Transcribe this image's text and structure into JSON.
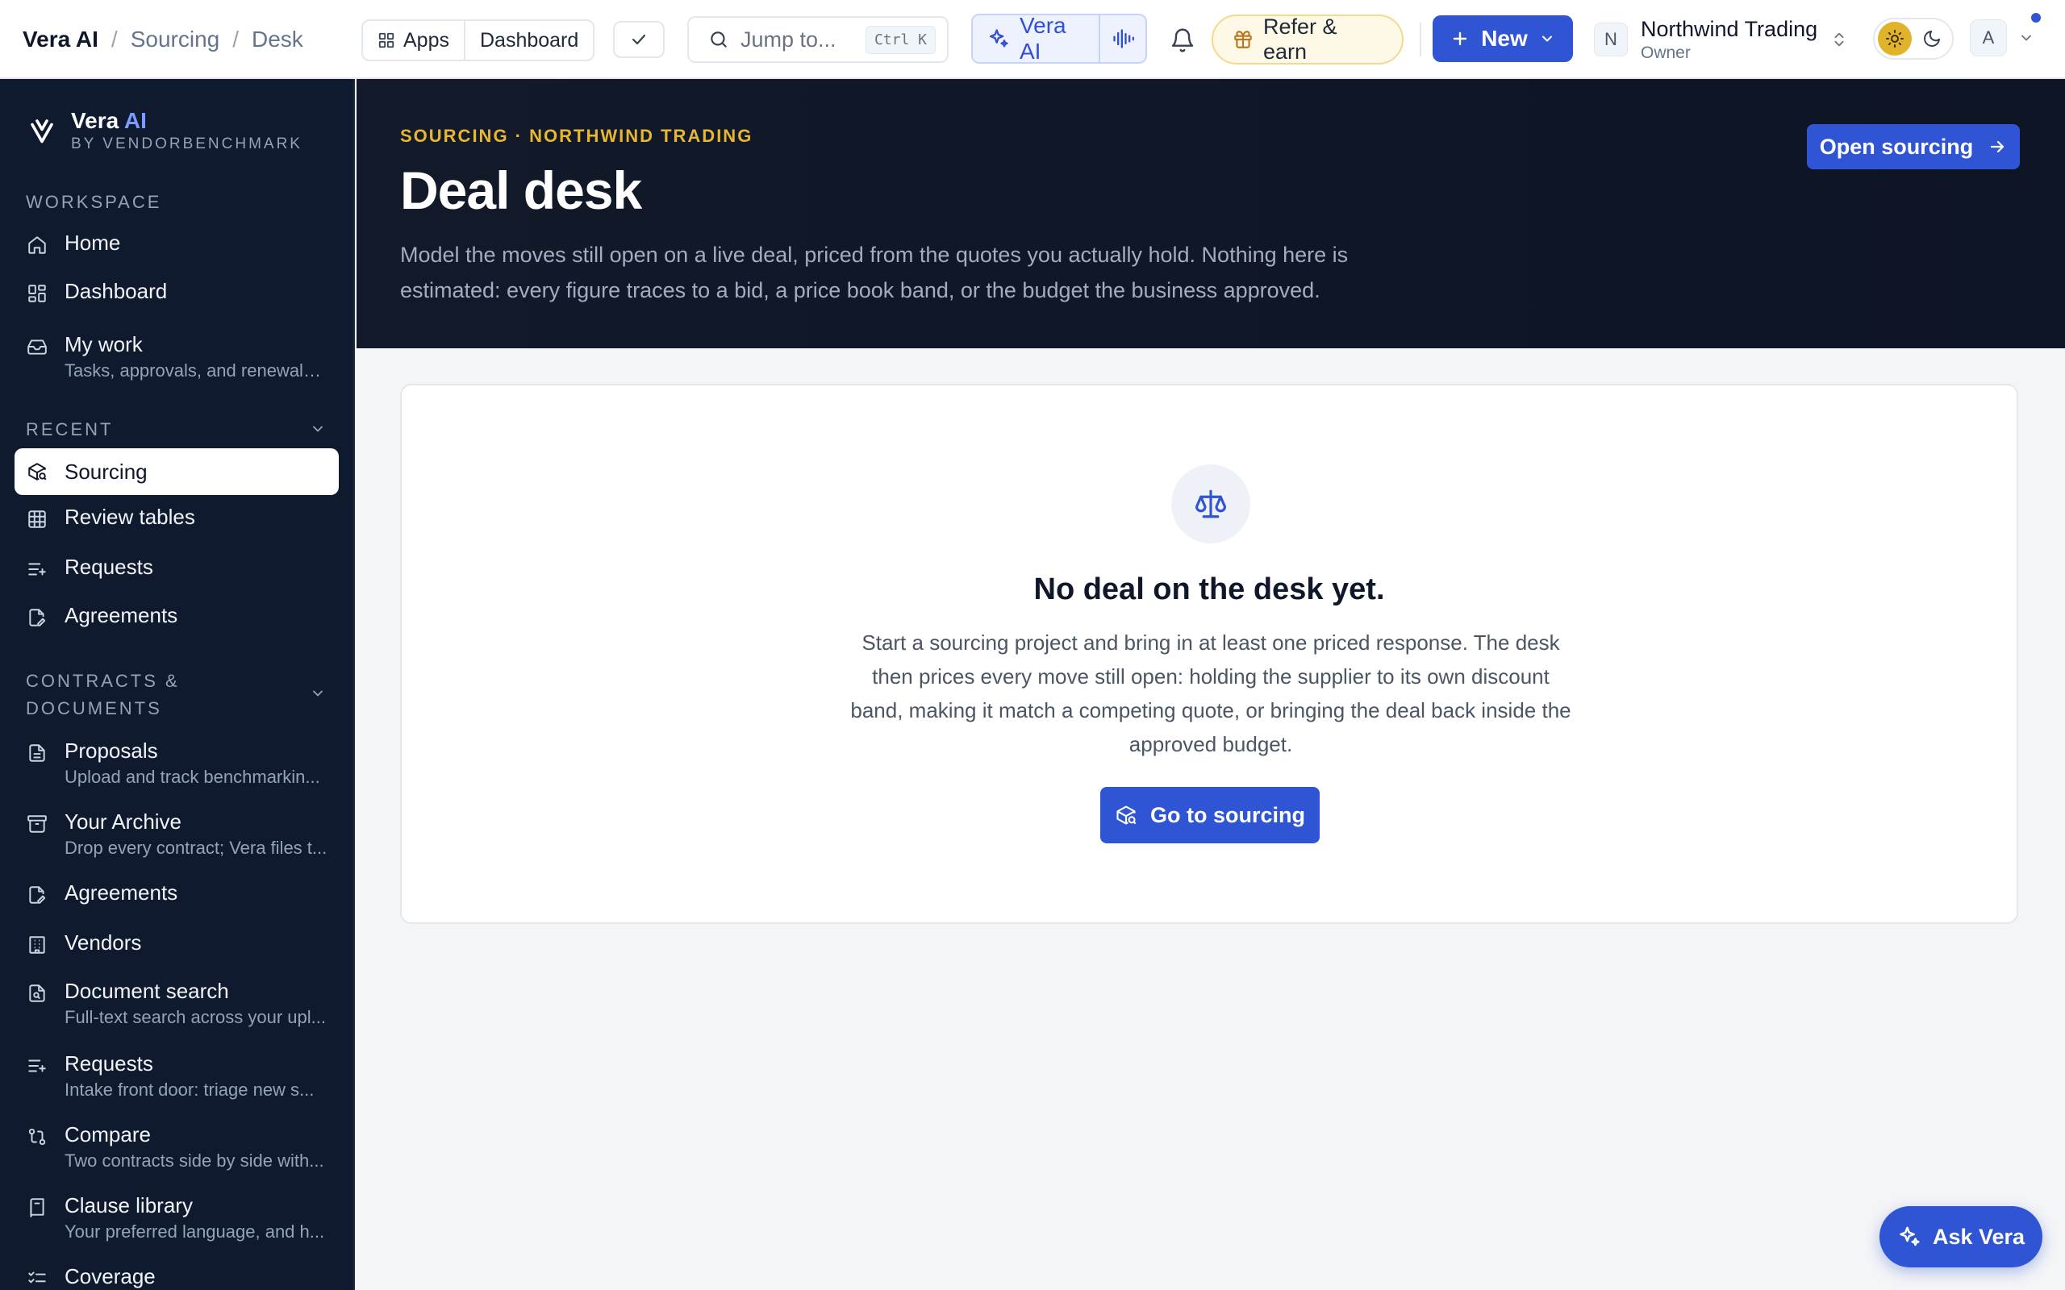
{
  "breadcrumb": {
    "root": "Vera AI",
    "items": [
      "Sourcing",
      "Desk"
    ],
    "separator": "/"
  },
  "topbar": {
    "apps_label": "Apps",
    "dashboard_label": "Dashboard",
    "search_placeholder": "Jump to...",
    "search_shortcut": "Ctrl K",
    "vera_label": "Vera AI",
    "refer_label": "Refer & earn",
    "new_label": "New",
    "org": {
      "initial": "N",
      "name": "Northwind Trading",
      "role": "Owner"
    },
    "user_initial": "A",
    "icons": [
      "grid-icon",
      "check-icon",
      "search-icon",
      "sparkle-icon",
      "waveform-icon",
      "bell-icon",
      "gift-icon",
      "plus-icon",
      "chevron-down-icon",
      "chevron-updown-icon",
      "sun-icon",
      "moon-icon"
    ]
  },
  "sidebar": {
    "brand": {
      "name": "Vera",
      "name_accent": "AI",
      "subtitle": "BY VENDORBENCHMARK"
    },
    "sections": {
      "workspace": "WORKSPACE",
      "recent": "RECENT",
      "contracts": [
        "CONTRACTS &",
        "DOCUMENTS"
      ]
    },
    "workspace_items": [
      {
        "label": "Home",
        "icon": "home-icon"
      },
      {
        "label": "Dashboard",
        "icon": "dashboard-icon"
      },
      {
        "label": "My work",
        "desc": "Tasks, approvals, and renewals ...",
        "icon": "inbox-icon"
      }
    ],
    "recent_items": [
      {
        "label": "Sourcing",
        "icon": "package-search-icon",
        "active": true
      },
      {
        "label": "Review tables",
        "icon": "table-icon"
      },
      {
        "label": "Requests",
        "icon": "list-plus-icon"
      },
      {
        "label": "Agreements",
        "icon": "file-pen-icon"
      }
    ],
    "contract_items": [
      {
        "label": "Proposals",
        "desc": "Upload and track benchmarkin...",
        "icon": "file-text-icon"
      },
      {
        "label": "Your Archive",
        "desc": "Drop every contract; Vera files t...",
        "icon": "archive-icon"
      },
      {
        "label": "Agreements",
        "icon": "file-pen-icon"
      },
      {
        "label": "Vendors",
        "icon": "building-icon"
      },
      {
        "label": "Document search",
        "desc": "Full-text search across your upl...",
        "icon": "file-search-icon"
      },
      {
        "label": "Requests",
        "desc": "Intake front door: triage new s...",
        "icon": "list-plus-icon"
      },
      {
        "label": "Compare",
        "desc": "Two contracts side by side with...",
        "icon": "git-compare-icon"
      },
      {
        "label": "Clause library",
        "desc": "Your preferred language, and h...",
        "icon": "book-icon"
      },
      {
        "label": "Coverage",
        "icon": "list-check-icon"
      }
    ]
  },
  "hero": {
    "eyebrow": "SOURCING · NORTHWIND TRADING",
    "title": "Deal desk",
    "description": "Model the moves still open on a live deal, priced from the quotes you actually hold. Nothing here is estimated: every figure traces to a bid, a price book band, or the budget the business approved.",
    "open_button": "Open sourcing"
  },
  "empty_state": {
    "icon": "scale-icon",
    "title": "No deal on the desk yet.",
    "description": "Start a sourcing project and bring in at least one priced response. The desk then prices every move still open: holding the supplier to its own discount band, making it match a competing quote, or bringing the deal back inside the approved budget.",
    "button": "Go to sourcing"
  },
  "ask_vera": "Ask Vera",
  "colors": {
    "primary": "#2f55d4",
    "sidebar_bg": "#0f1a2e",
    "hero_bg": "#121a2a",
    "eyebrow": "#e8b631",
    "brand_accent": "#7c9cff"
  }
}
